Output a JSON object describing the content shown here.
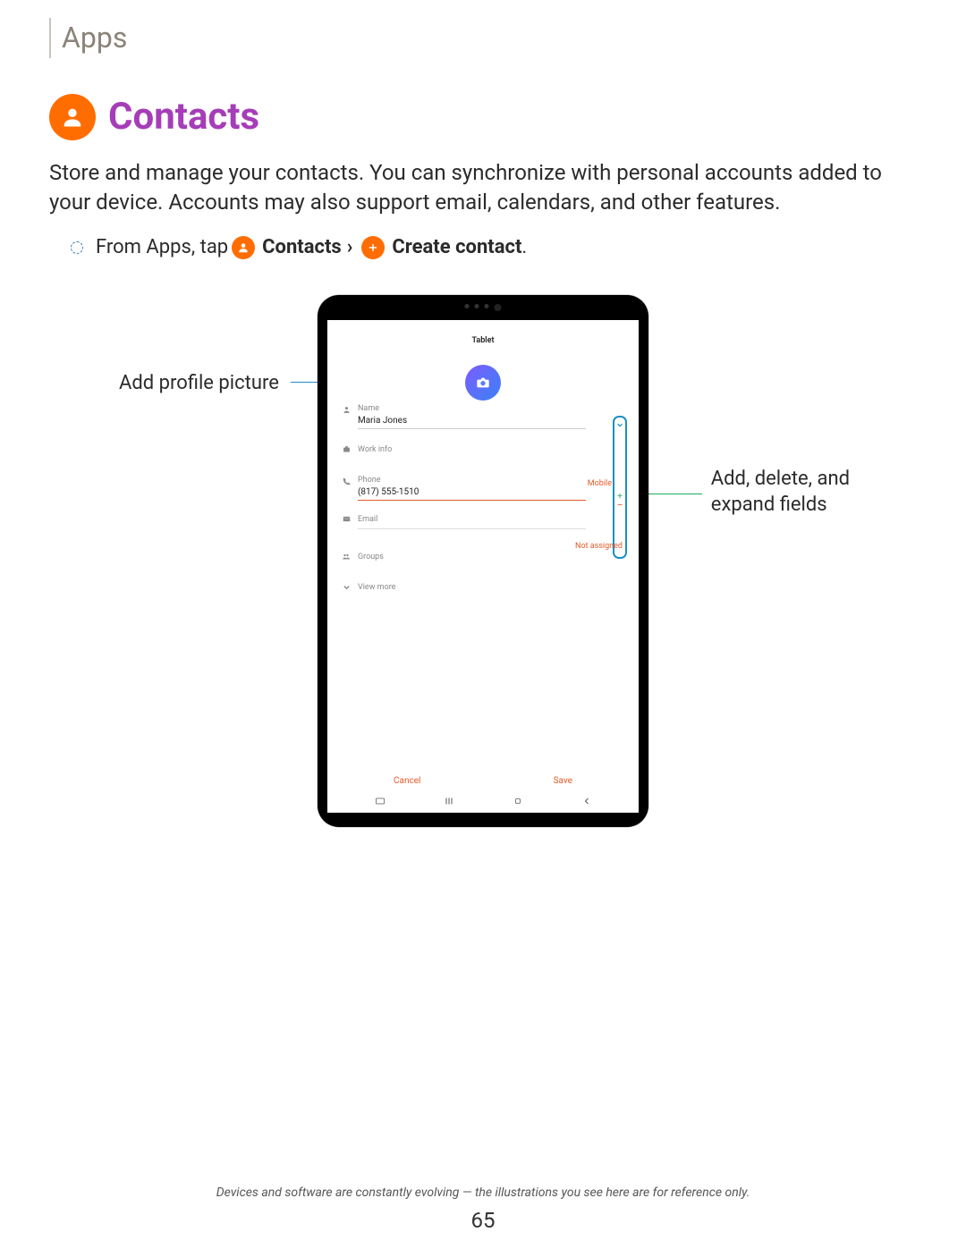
{
  "section": "Apps",
  "title": "Contacts",
  "intro": "Store and manage your contacts. You can synchronize with personal accounts added to your device. Accounts may also support email, calendars, and other features.",
  "step": {
    "prefix": "From Apps, tap ",
    "contacts": "Contacts",
    "chevron": "›",
    "create": "Create contact",
    "period": "."
  },
  "callouts": {
    "left": "Add profile picture",
    "right_line1": "Add, delete, and",
    "right_line2": "expand fields"
  },
  "device": {
    "header": "Tablet",
    "fields": {
      "name_label": "Name",
      "name_value": "Maria Jones",
      "work_label": "Work info",
      "phone_label": "Phone",
      "phone_value": "(817) 555-1510",
      "phone_tag": "Mobile",
      "email_label": "Email",
      "groups_label": "Groups",
      "groups_tag": "Not assigned",
      "viewmore": "View more"
    },
    "actions": {
      "cancel": "Cancel",
      "save": "Save"
    }
  },
  "disclaimer": "Devices and software are constantly evolving — the illustrations you see here are for reference only.",
  "page_num": "65"
}
